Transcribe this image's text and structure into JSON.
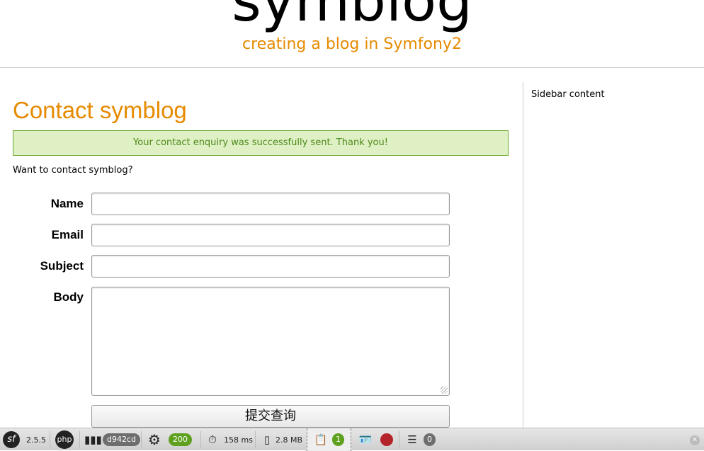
{
  "header": {
    "logo": "symblog",
    "tagline": "creating a blog in Symfony2"
  },
  "main": {
    "title": "Contact symblog",
    "notice": "Your contact enquiry was successfully sent. Thank you!",
    "intro": "Want to contact symblog?",
    "form": {
      "name_label": "Name",
      "email_label": "Email",
      "subject_label": "Subject",
      "body_label": "Body",
      "name_value": "",
      "email_value": "",
      "subject_value": "",
      "body_value": "",
      "submit_label": "提交查询"
    }
  },
  "sidebar": {
    "content": "Sidebar content"
  },
  "toolbar": {
    "symfony_version": "2.5.5",
    "php_label": "php",
    "token": "d942cd",
    "status_code": "200",
    "time": "158 ms",
    "memory": "2.8 MB",
    "logs_count": "1",
    "db_count": "0",
    "colors": {
      "status_ok": "#5fa11e",
      "error": "#b5232a",
      "badge": "#6e6e6e"
    }
  },
  "colors": {
    "accent": "#e68a00",
    "success_bg": "#dff0c4",
    "success_text": "#4d8a1a"
  }
}
